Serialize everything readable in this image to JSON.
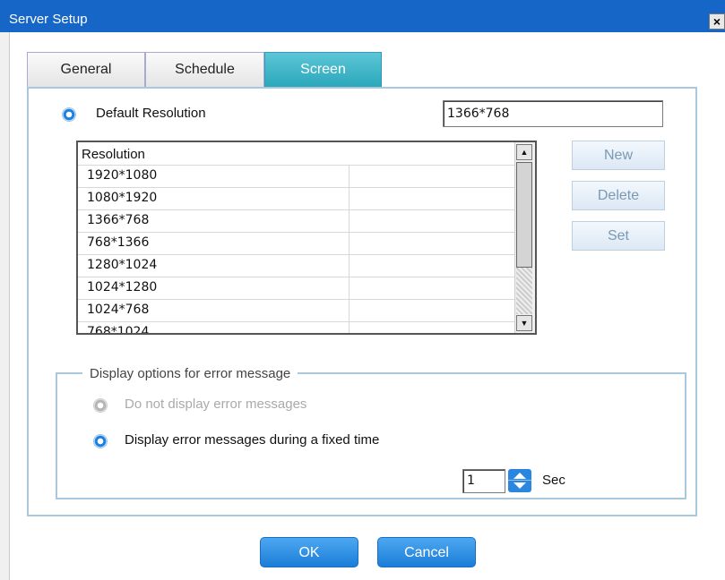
{
  "window": {
    "title": "Server Setup",
    "close_glyph": "×"
  },
  "tabs": [
    {
      "label": "General",
      "active": false
    },
    {
      "label": "Schedule",
      "active": false
    },
    {
      "label": "Screen",
      "active": true
    }
  ],
  "default_resolution": {
    "label": "Default Resolution",
    "value": "1366*768",
    "selected": true
  },
  "resolution_list": {
    "header": "Resolution",
    "rows": [
      "1920*1080",
      "1080*1920",
      "1366*768",
      "768*1366",
      "1280*1024",
      "1024*1280",
      "1024*768",
      "768*1024"
    ]
  },
  "side_buttons": {
    "new": "New",
    "delete": "Delete",
    "set": "Set"
  },
  "error_group": {
    "legend": "Display options for error message",
    "option_no_display": {
      "label": "Do not display error messages",
      "selected": false,
      "disabled": true
    },
    "option_fixed_time": {
      "label": "Display error messages during a fixed time",
      "selected": true
    },
    "seconds_value": "1",
    "seconds_unit": "Sec"
  },
  "buttons": {
    "ok": "OK",
    "cancel": "Cancel"
  },
  "icons": {
    "close": "close-icon",
    "spin_up": "spin-up-icon",
    "spin_down": "spin-down-icon",
    "scroll_up": "scroll-up-arrow-icon",
    "scroll_down": "scroll-down-arrow-icon"
  },
  "colors": {
    "titlebar": "#1566c6",
    "active_tab": "#2aa6ba",
    "primary_button": "#1a7dd8",
    "border": "#a9c7dd"
  }
}
